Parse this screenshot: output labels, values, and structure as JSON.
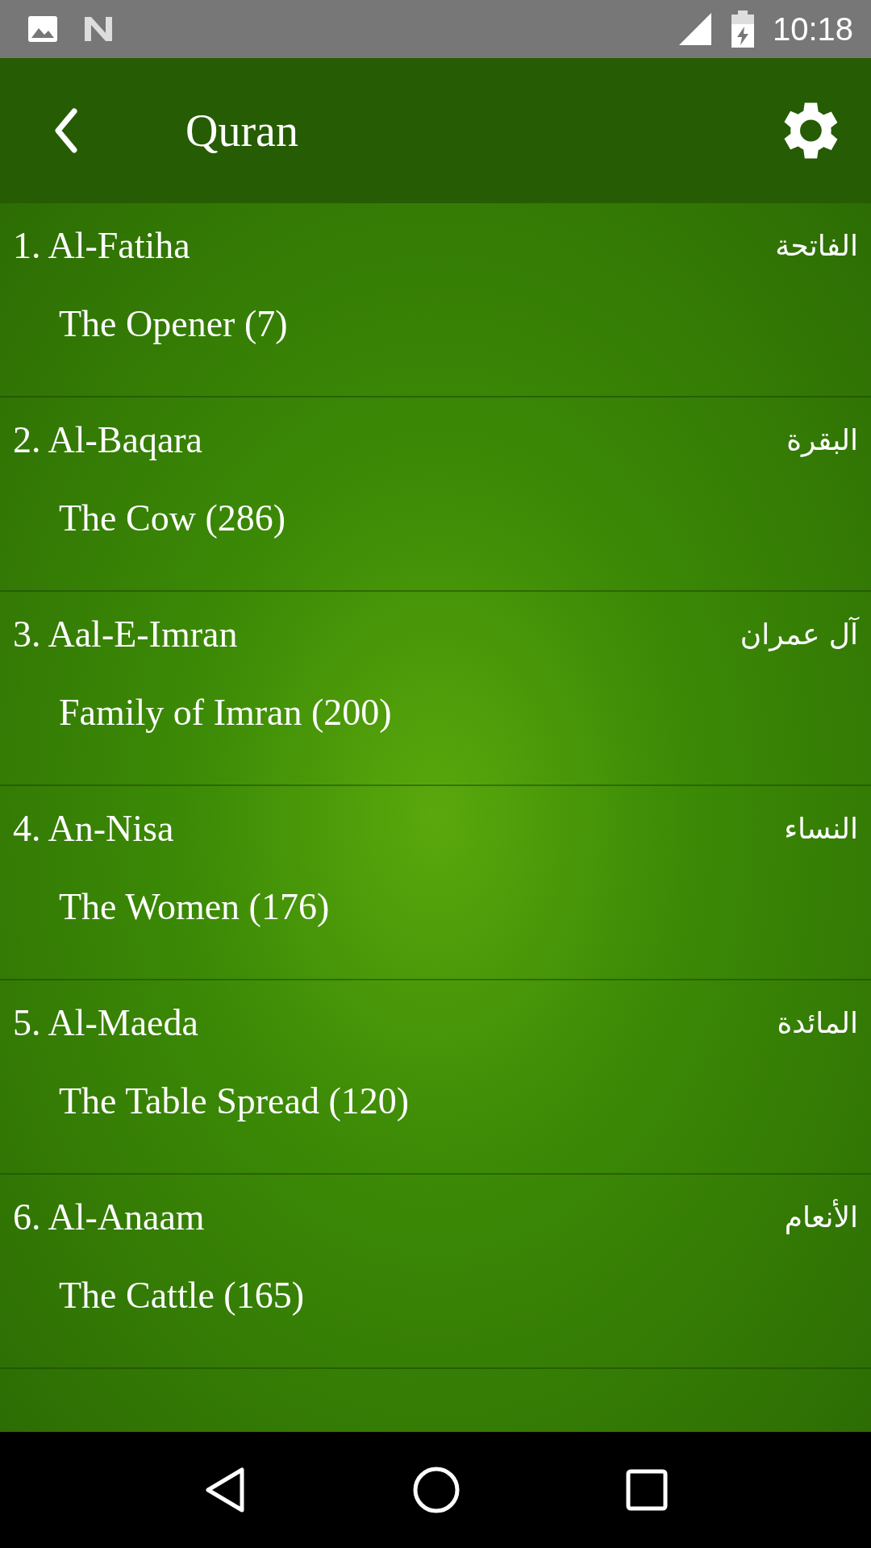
{
  "status_bar": {
    "time": "10:18"
  },
  "app_bar": {
    "title": "Quran"
  },
  "surahs": [
    {
      "title": "1. Al-Fatiha",
      "arabic": "الفاتحة",
      "meaning": "The Opener (7)"
    },
    {
      "title": "2. Al-Baqara",
      "arabic": "البقرة",
      "meaning": "The Cow (286)"
    },
    {
      "title": "3. Aal-E-Imran",
      "arabic": "آل عمران",
      "meaning": "Family of Imran (200)"
    },
    {
      "title": "4. An-Nisa",
      "arabic": "النساء",
      "meaning": "The Women (176)"
    },
    {
      "title": "5. Al-Maeda",
      "arabic": "المائدة",
      "meaning": "The Table Spread (120)"
    },
    {
      "title": "6. Al-Anaam",
      "arabic": "الأنعام",
      "meaning": "The Cattle (165)"
    }
  ]
}
